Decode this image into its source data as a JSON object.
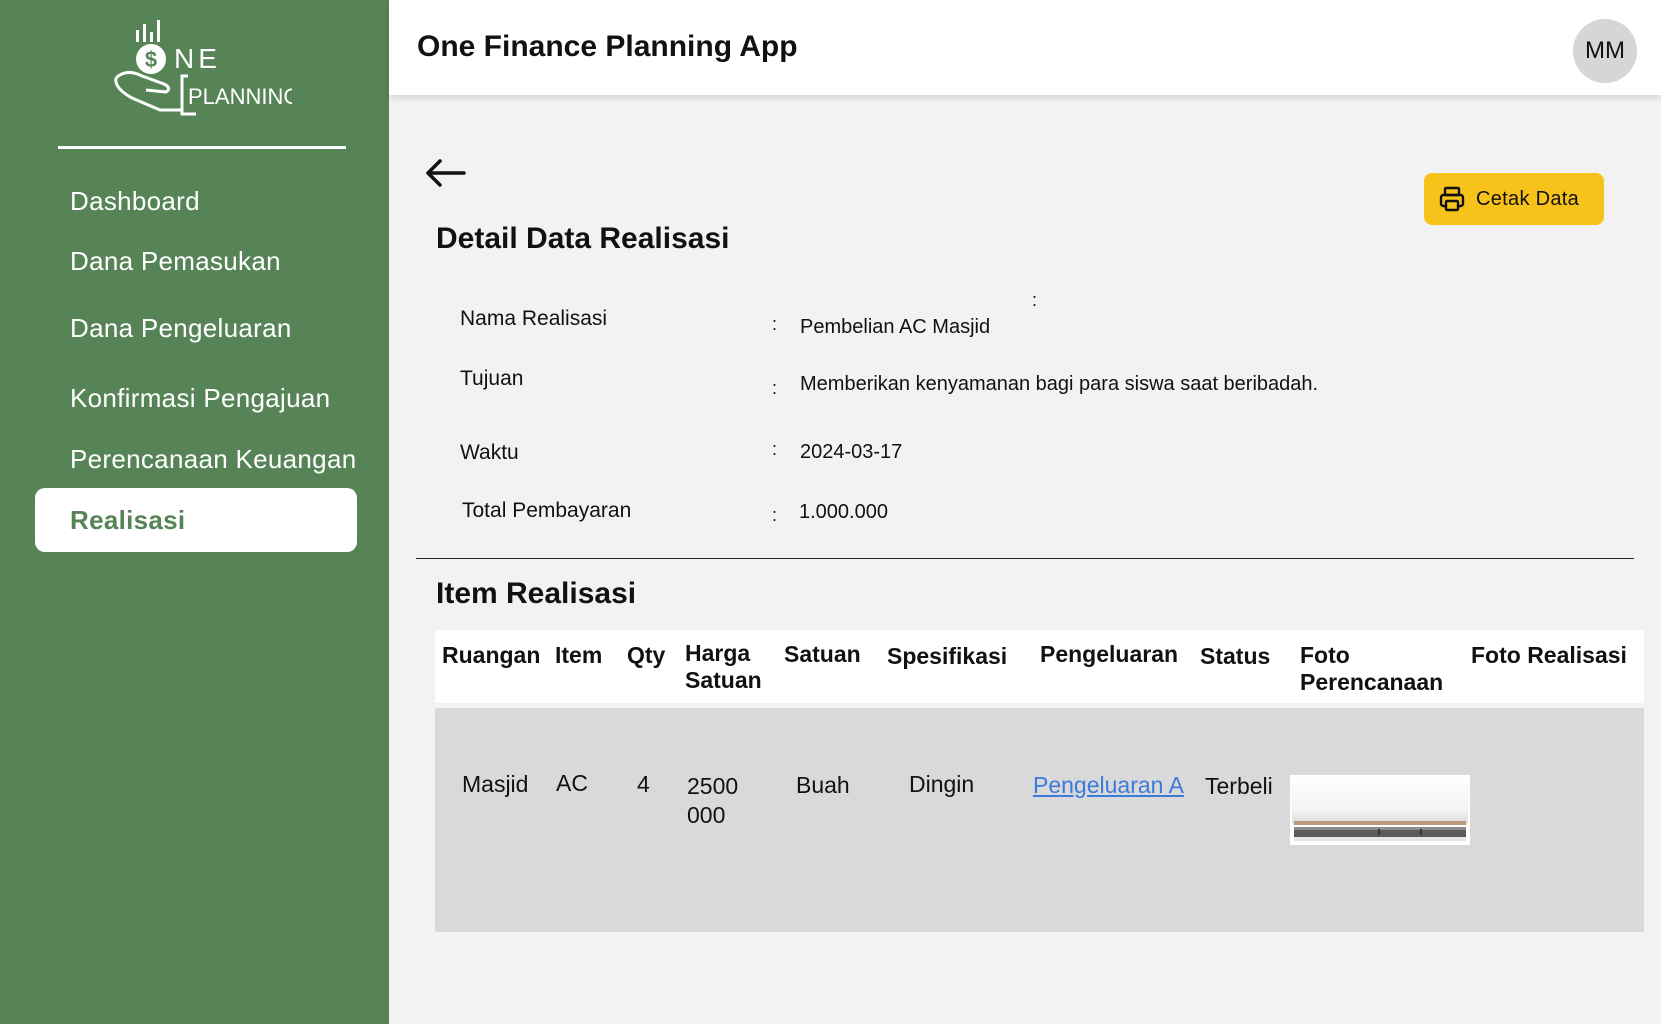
{
  "brand": {
    "logo_line1": "NE",
    "logo_line2": "PLANNING",
    "logo_symbol": "$"
  },
  "sidebar": {
    "items": [
      {
        "label": "Dashboard"
      },
      {
        "label": "Dana Pemasukan"
      },
      {
        "label": "Dana Pengeluaran"
      },
      {
        "label": "Konfirmasi Pengajuan"
      },
      {
        "label": "Perencanaan Keuangan"
      },
      {
        "label": "Realisasi",
        "active": true
      }
    ]
  },
  "header": {
    "title": "One Finance Planning App",
    "avatar_initials": "MM"
  },
  "toolbar": {
    "back_icon": "arrow-left-icon",
    "print_icon": "printer-icon",
    "print_label": "Cetak Data"
  },
  "detail": {
    "title": "Detail Data Realisasi",
    "stray_colon": ":",
    "fields": [
      {
        "label": "Nama Realisasi",
        "colon": ":",
        "value": "Pembelian AC Masjid"
      },
      {
        "label": "Tujuan",
        "colon": ":",
        "value": "Memberikan kenyamanan bagi para siswa saat beribadah."
      },
      {
        "label": "Waktu",
        "colon": ":",
        "value": "2024-03-17"
      },
      {
        "label": "Total Pembayaran",
        "colon": ":",
        "value": "1.000.000"
      }
    ]
  },
  "items": {
    "title": "Item Realisasi",
    "columns": [
      {
        "line1": "Ruangan",
        "line2": ""
      },
      {
        "line1": "Item",
        "line2": ""
      },
      {
        "line1": "Qty",
        "line2": ""
      },
      {
        "line1": "Harga",
        "line2": "Satuan"
      },
      {
        "line1": "Satuan",
        "line2": ""
      },
      {
        "line1": "Spesifikasi",
        "line2": ""
      },
      {
        "line1": "Pengeluaran",
        "line2": ""
      },
      {
        "line1": "Status",
        "line2": ""
      },
      {
        "line1": "Foto",
        "line2": "Perencanaan"
      },
      {
        "line1": "Foto Realisasi",
        "line2": ""
      }
    ],
    "rows": [
      {
        "ruangan": "Masjid",
        "item": "AC",
        "qty": "4",
        "harga_line1": "2500",
        "harga_line2": "000",
        "satuan": "Buah",
        "spesifikasi": "Dingin",
        "pengeluaran": "Pengeluaran A",
        "status": "Terbeli",
        "foto_perencanaan": "air-conditioner-photo"
      }
    ]
  },
  "colors": {
    "sidebar_bg": "#578457",
    "accent_button": "#f7c21a",
    "link": "#3a7bdc",
    "row_bg": "#d9d9d9",
    "page_bg": "#f2f2f2"
  }
}
